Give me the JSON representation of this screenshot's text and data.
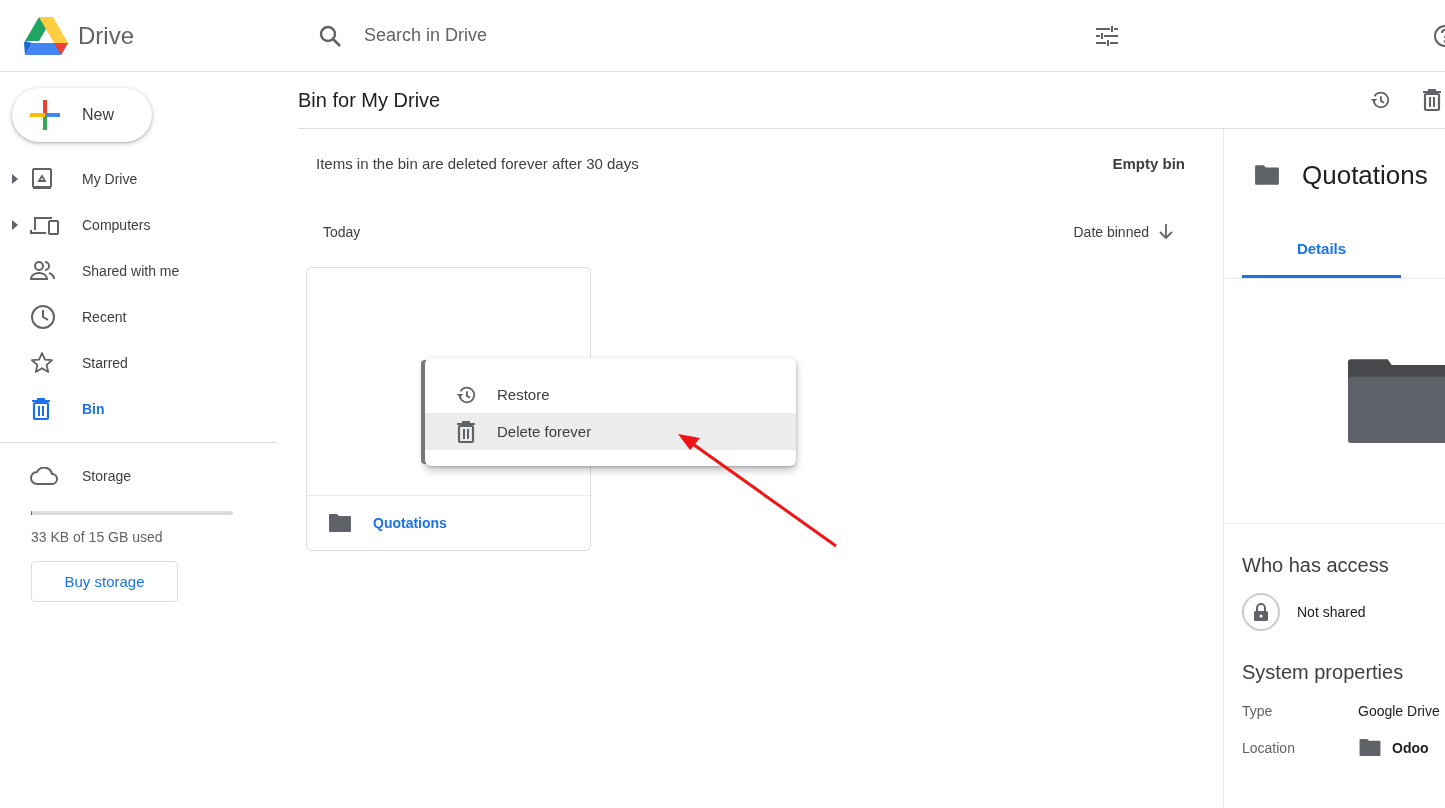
{
  "header": {
    "app_name": "Drive",
    "search": {
      "placeholder": "Search in Drive"
    }
  },
  "sidebar": {
    "new_button": "New",
    "items": [
      {
        "label": "My Drive",
        "kind": "my-drive",
        "expandable": true,
        "selected": false
      },
      {
        "label": "Computers",
        "kind": "computers",
        "expandable": true,
        "selected": false
      },
      {
        "label": "Shared with me",
        "kind": "shared",
        "expandable": false,
        "selected": false
      },
      {
        "label": "Recent",
        "kind": "recent",
        "expandable": false,
        "selected": false
      },
      {
        "label": "Starred",
        "kind": "starred",
        "expandable": false,
        "selected": false
      },
      {
        "label": "Bin",
        "kind": "bin",
        "expandable": false,
        "selected": true
      }
    ],
    "storage": {
      "label": "Storage",
      "level": 0.003,
      "usage": "33 KB of 15 GB used",
      "buy_button": "Buy storage"
    }
  },
  "main": {
    "title": "Bin for My Drive",
    "notice": "Items in the bin are deleted forever after 30 days",
    "empty_bin": "Empty bin",
    "section": "Today",
    "sort": "Date binned",
    "files": [
      {
        "name": "Quotations"
      }
    ],
    "context_menu": [
      {
        "label": "Restore",
        "kind": "restore",
        "selected": false
      },
      {
        "label": "Delete forever",
        "kind": "delete",
        "selected": true
      }
    ]
  },
  "details": {
    "title": "Quotations",
    "tabs": [
      {
        "label": "Details",
        "selected": true
      }
    ],
    "access_heading": "Who has access",
    "sharing": "Not shared",
    "properties_heading": "System properties",
    "properties": [
      {
        "label": "Type",
        "value": "Google Drive",
        "kind": "text"
      },
      {
        "label": "Location",
        "value": "Odoo",
        "kind": "folder"
      }
    ]
  }
}
